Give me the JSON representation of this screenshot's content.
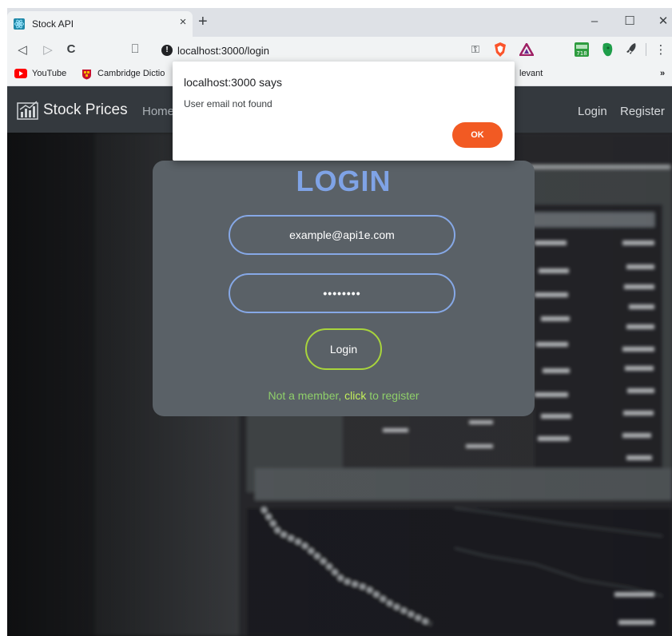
{
  "browser": {
    "tab": {
      "title": "Stock API",
      "close_glyph": "×",
      "favicon": "react-icon"
    },
    "new_tab_glyph": "+",
    "window_controls": {
      "minimize": "–",
      "maximize": "☐",
      "close": "✕"
    },
    "nav": {
      "back": "◁",
      "forward": "▷",
      "reload": "C",
      "bookmark": "⎕"
    },
    "address": {
      "url": "localhost:3000/login",
      "info_glyph": "!",
      "key_glyph": "⚿"
    },
    "extensions": {
      "menu_glyph": "⋮",
      "chevron": "»",
      "ext_badge": "718"
    },
    "bookmarks": [
      {
        "label": "YouTube",
        "icon": "youtube-icon"
      },
      {
        "label": "Cambridge Dictio",
        "icon": "cambridge-icon"
      },
      {
        "label": "levant",
        "icon": ""
      }
    ]
  },
  "page": {
    "brand": "Stock Prices",
    "nav": {
      "home": "Home",
      "login": "Login",
      "register": "Register"
    },
    "login": {
      "title": "LOGIN",
      "email": "example@api1e.com",
      "password_mask": "••••••••",
      "button": "Login",
      "register_prefix": "Not a member, ",
      "register_link": "click",
      "register_suffix": " to register"
    }
  },
  "alert": {
    "title": "localhost:3000 says",
    "message": "User email not found",
    "ok": "OK"
  },
  "colors": {
    "accent_blue": "#7fa3e6",
    "button_border": "#a8d43c",
    "link_green": "#8fcf6a",
    "ok_orange": "#f25a23"
  }
}
